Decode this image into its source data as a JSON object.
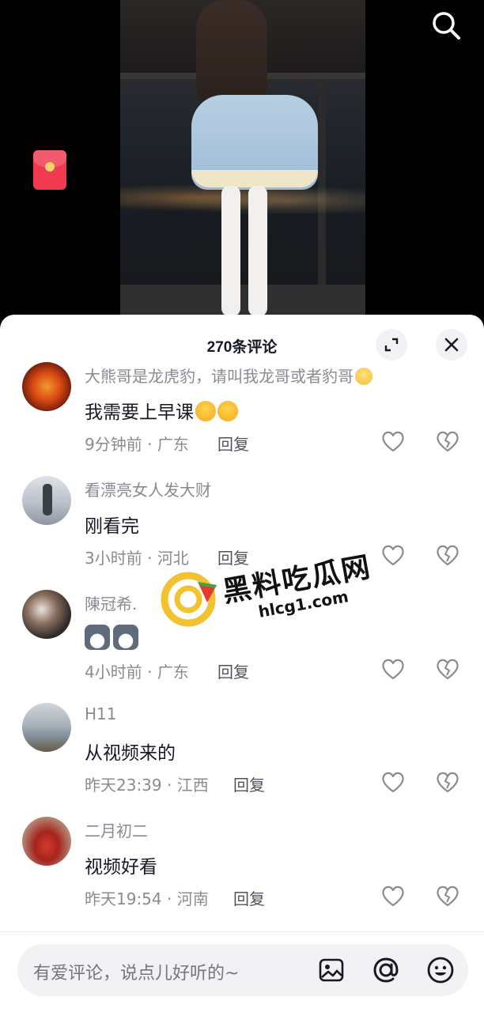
{
  "header": {
    "comment_count_title": "270条评论"
  },
  "comments": [
    {
      "user": "大熊哥是龙虎豹，请叫我龙哥或者豹哥",
      "text": "我需要上早课",
      "time": "9分钟前",
      "location": "广东",
      "reply_label": "回复",
      "avatar_colors": [
        "#6b1a0c",
        "#d94a12",
        "#f29a2e"
      ]
    },
    {
      "user": "看漂亮女人发大财",
      "text": "刚看完",
      "time": "3小时前",
      "location": "河北",
      "reply_label": "回复",
      "avatar_colors": [
        "#d9dde2",
        "#8d97a3",
        "#3b3f46"
      ]
    },
    {
      "user": "陳冠希.",
      "text": "",
      "time": "4小时前",
      "location": "广东",
      "reply_label": "回复",
      "avatar_colors": [
        "#2d2a28",
        "#8a6e5e",
        "#e9e5e0"
      ]
    },
    {
      "user": "H11",
      "text": "从视频来的",
      "time": "昨天23:39",
      "location": "江西",
      "reply_label": "回复",
      "avatar_colors": [
        "#c9d0d6",
        "#7f8c96",
        "#6b5a45"
      ]
    },
    {
      "user": "二月初二",
      "text": "视频好看",
      "time": "昨天19:54",
      "location": "河南",
      "reply_label": "回复",
      "avatar_colors": [
        "#b48572",
        "#d8392e",
        "#7a1d18"
      ]
    }
  ],
  "meta_separator": " · ",
  "watermark": {
    "title": "黑料吃瓜网",
    "url": "hlcg1.com"
  },
  "input": {
    "placeholder": "有爱评论，说点儿好听的~"
  },
  "icons": {
    "search": "search-icon",
    "red_packet": "red-packet-icon",
    "expand": "expand-icon",
    "close": "close-icon",
    "like": "heart-icon",
    "dislike": "broken-heart-icon",
    "image": "image-icon",
    "mention": "at-icon",
    "emoji": "emoji-icon"
  },
  "colors": {
    "sheet_bg": "#ffffff",
    "primary_text": "#161823",
    "secondary_text": "#8a8b91",
    "input_bg": "#f2f2f4",
    "red_packet": "#ef3a52"
  }
}
